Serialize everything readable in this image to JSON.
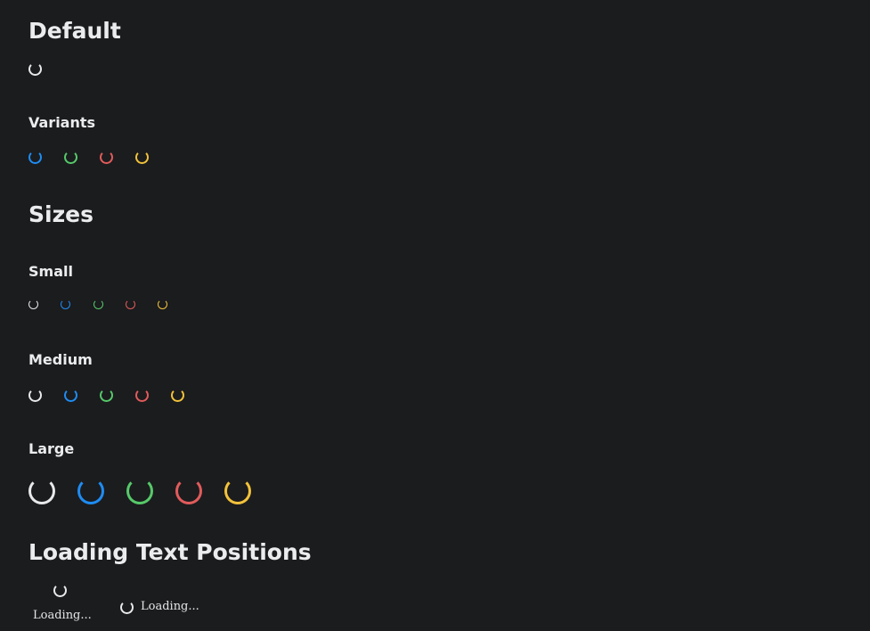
{
  "sections": {
    "default": {
      "title": "Default"
    },
    "variants": {
      "title": "Variants"
    },
    "sizes": {
      "title": "Sizes",
      "small": "Small",
      "medium": "Medium",
      "large": "Large"
    },
    "loading_text_positions": {
      "title": "Loading Text Positions",
      "below_text": "Loading...",
      "right_text": "Loading..."
    }
  },
  "spinner_colors": {
    "default": "#e8e9ea",
    "primary": "#1f8cf2",
    "success": "#56c96a",
    "danger": "#e25b5b",
    "warning": "#f2c23a"
  },
  "icons": {
    "spinner": "spinner-icon"
  }
}
